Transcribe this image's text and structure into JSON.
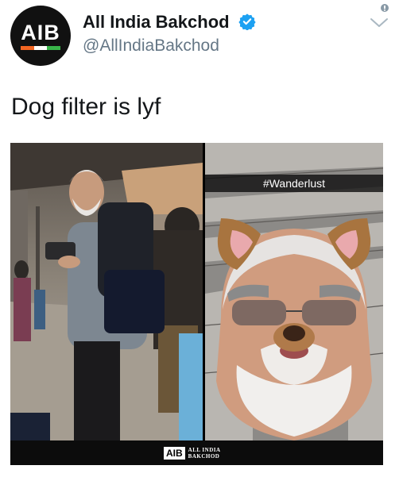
{
  "account": {
    "avatar_text": "AIB",
    "display_name": "All India Bakchod",
    "handle": "@AllIndiaBakchod",
    "verified": true
  },
  "tweet": {
    "text": "Dog filter is lyf"
  },
  "media": {
    "overlay_caption": "#Wanderlust",
    "watermark": {
      "logo_text": "AIB",
      "name_line1": "ALL INDIA",
      "name_line2": "BAKCHOD"
    }
  },
  "icons": {
    "verified": "verified-badge-icon",
    "menu": "chevron-down-icon"
  },
  "colors": {
    "verified_blue": "#1da1f2",
    "handle_grey": "#657786",
    "stripe_orange": "#f26522",
    "stripe_white": "#ffffff",
    "stripe_green": "#39b54a"
  }
}
